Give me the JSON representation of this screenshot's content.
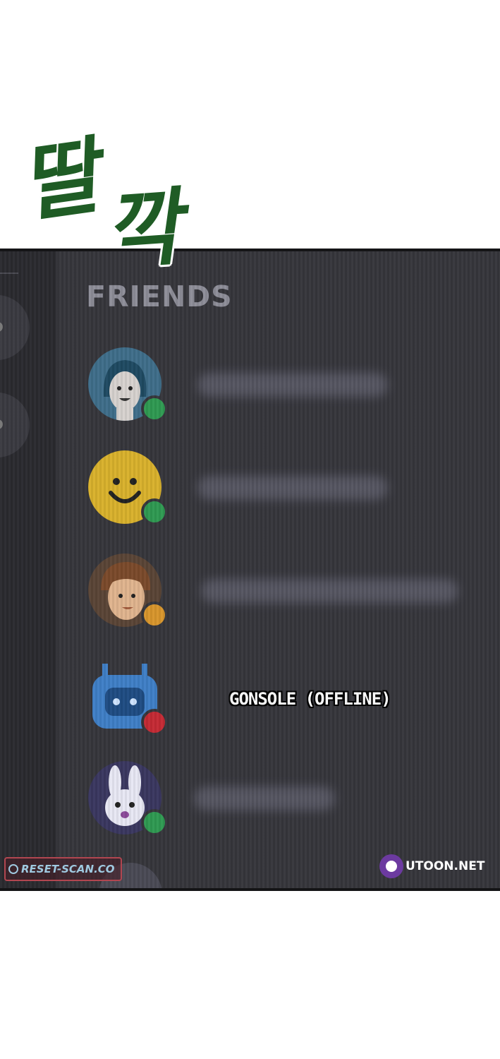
{
  "sound_effect": {
    "text_part1": "딸",
    "text_part2": "깍"
  },
  "section_title": "FRIENDS",
  "friends": [
    {
      "avatar": "woman-avatar-icon",
      "status_color": "#2f9a52",
      "label": ""
    },
    {
      "avatar": "smiley-avatar-icon",
      "status_color": "#2f9a52",
      "label": ""
    },
    {
      "avatar": "man-avatar-icon",
      "status_color": "#d8962c",
      "label": ""
    },
    {
      "avatar": "robot-avatar-icon",
      "status_color": "#c52a34",
      "label": "GONSOLE (OFFLINE)"
    },
    {
      "avatar": "bunny-avatar-icon",
      "status_color": "#2f9a52",
      "label": ""
    }
  ],
  "watermarks": {
    "left": "RESET-SCAN.CO",
    "right": "UTOON.NET"
  }
}
